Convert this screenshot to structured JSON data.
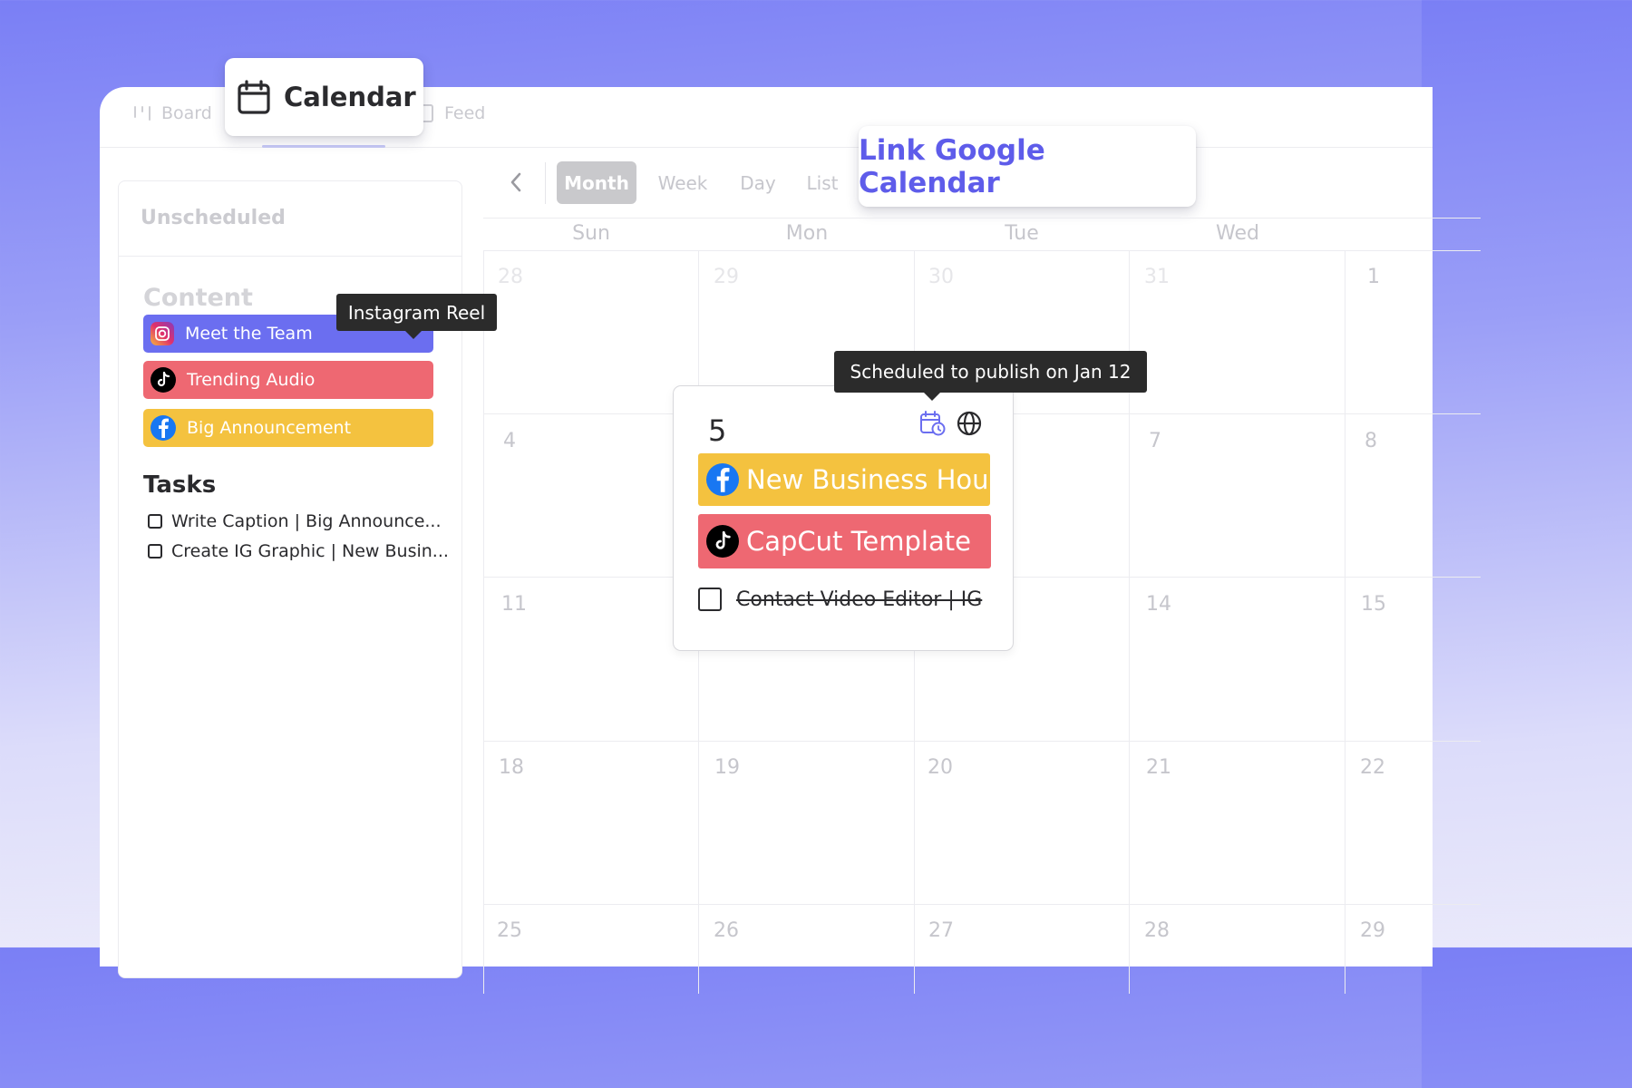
{
  "tabs": {
    "board": "Board",
    "calendar": "Calendar",
    "feed": "Feed"
  },
  "sidebar": {
    "heading": "Unscheduled",
    "content_title": "Content",
    "content_items": [
      {
        "label": "Meet the Team",
        "platform": "instagram",
        "color": "#6b6ef0"
      },
      {
        "label": "Trending Audio",
        "platform": "tiktok",
        "color": "#ee6872"
      },
      {
        "label": "Big Announcement",
        "platform": "facebook",
        "color": "#f4c23f"
      }
    ],
    "tasks_title": "Tasks",
    "tasks": [
      {
        "label": "Write Caption | Big Announce..."
      },
      {
        "label": "Create IG Graphic | New Busin..."
      }
    ]
  },
  "toolbar": {
    "views": [
      "Month",
      "Week",
      "Day",
      "List"
    ],
    "active_view": "Month"
  },
  "link_google_calendar": "Link Google Calendar",
  "calendar": {
    "weekdays": [
      "Sun",
      "Mon",
      "Tue",
      "Wed"
    ],
    "weeks": [
      [
        "28",
        "29",
        "30",
        "31",
        "1"
      ],
      [
        "4",
        "",
        "",
        "7",
        "8"
      ],
      [
        "11",
        "",
        "",
        "14",
        "15"
      ],
      [
        "18",
        "19",
        "20",
        "21",
        "22"
      ],
      [
        "25",
        "26",
        "27",
        "28",
        "29"
      ]
    ]
  },
  "tooltips": {
    "reel": "Instagram Reel",
    "scheduled": "Scheduled to publish on Jan 12"
  },
  "day_card": {
    "day": "5",
    "events": [
      {
        "label": "New Business Hours",
        "platform": "facebook",
        "color": "#f4c23f"
      },
      {
        "label": "CapCut Template",
        "platform": "tiktok",
        "color": "#ee6872"
      }
    ],
    "task": {
      "label": "Contact Video Editor | IG",
      "done": true
    }
  },
  "colors": {
    "accent": "#5e5cea",
    "active_view_bg": "#c9c9cc"
  }
}
